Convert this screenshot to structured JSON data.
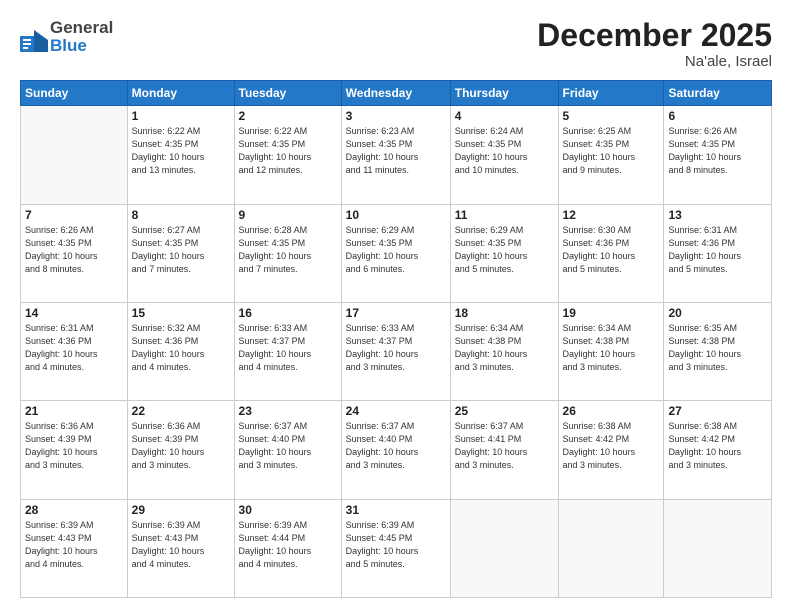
{
  "header": {
    "logo_general": "General",
    "logo_blue": "Blue",
    "title": "December 2025",
    "subtitle": "Na'ale, Israel"
  },
  "calendar": {
    "weekdays": [
      "Sunday",
      "Monday",
      "Tuesday",
      "Wednesday",
      "Thursday",
      "Friday",
      "Saturday"
    ],
    "weeks": [
      [
        {
          "day": "",
          "info": ""
        },
        {
          "day": "1",
          "info": "Sunrise: 6:22 AM\nSunset: 4:35 PM\nDaylight: 10 hours\nand 13 minutes."
        },
        {
          "day": "2",
          "info": "Sunrise: 6:22 AM\nSunset: 4:35 PM\nDaylight: 10 hours\nand 12 minutes."
        },
        {
          "day": "3",
          "info": "Sunrise: 6:23 AM\nSunset: 4:35 PM\nDaylight: 10 hours\nand 11 minutes."
        },
        {
          "day": "4",
          "info": "Sunrise: 6:24 AM\nSunset: 4:35 PM\nDaylight: 10 hours\nand 10 minutes."
        },
        {
          "day": "5",
          "info": "Sunrise: 6:25 AM\nSunset: 4:35 PM\nDaylight: 10 hours\nand 9 minutes."
        },
        {
          "day": "6",
          "info": "Sunrise: 6:26 AM\nSunset: 4:35 PM\nDaylight: 10 hours\nand 8 minutes."
        }
      ],
      [
        {
          "day": "7",
          "info": "Sunrise: 6:26 AM\nSunset: 4:35 PM\nDaylight: 10 hours\nand 8 minutes."
        },
        {
          "day": "8",
          "info": "Sunrise: 6:27 AM\nSunset: 4:35 PM\nDaylight: 10 hours\nand 7 minutes."
        },
        {
          "day": "9",
          "info": "Sunrise: 6:28 AM\nSunset: 4:35 PM\nDaylight: 10 hours\nand 7 minutes."
        },
        {
          "day": "10",
          "info": "Sunrise: 6:29 AM\nSunset: 4:35 PM\nDaylight: 10 hours\nand 6 minutes."
        },
        {
          "day": "11",
          "info": "Sunrise: 6:29 AM\nSunset: 4:35 PM\nDaylight: 10 hours\nand 5 minutes."
        },
        {
          "day": "12",
          "info": "Sunrise: 6:30 AM\nSunset: 4:36 PM\nDaylight: 10 hours\nand 5 minutes."
        },
        {
          "day": "13",
          "info": "Sunrise: 6:31 AM\nSunset: 4:36 PM\nDaylight: 10 hours\nand 5 minutes."
        }
      ],
      [
        {
          "day": "14",
          "info": "Sunrise: 6:31 AM\nSunset: 4:36 PM\nDaylight: 10 hours\nand 4 minutes."
        },
        {
          "day": "15",
          "info": "Sunrise: 6:32 AM\nSunset: 4:36 PM\nDaylight: 10 hours\nand 4 minutes."
        },
        {
          "day": "16",
          "info": "Sunrise: 6:33 AM\nSunset: 4:37 PM\nDaylight: 10 hours\nand 4 minutes."
        },
        {
          "day": "17",
          "info": "Sunrise: 6:33 AM\nSunset: 4:37 PM\nDaylight: 10 hours\nand 3 minutes."
        },
        {
          "day": "18",
          "info": "Sunrise: 6:34 AM\nSunset: 4:38 PM\nDaylight: 10 hours\nand 3 minutes."
        },
        {
          "day": "19",
          "info": "Sunrise: 6:34 AM\nSunset: 4:38 PM\nDaylight: 10 hours\nand 3 minutes."
        },
        {
          "day": "20",
          "info": "Sunrise: 6:35 AM\nSunset: 4:38 PM\nDaylight: 10 hours\nand 3 minutes."
        }
      ],
      [
        {
          "day": "21",
          "info": "Sunrise: 6:36 AM\nSunset: 4:39 PM\nDaylight: 10 hours\nand 3 minutes."
        },
        {
          "day": "22",
          "info": "Sunrise: 6:36 AM\nSunset: 4:39 PM\nDaylight: 10 hours\nand 3 minutes."
        },
        {
          "day": "23",
          "info": "Sunrise: 6:37 AM\nSunset: 4:40 PM\nDaylight: 10 hours\nand 3 minutes."
        },
        {
          "day": "24",
          "info": "Sunrise: 6:37 AM\nSunset: 4:40 PM\nDaylight: 10 hours\nand 3 minutes."
        },
        {
          "day": "25",
          "info": "Sunrise: 6:37 AM\nSunset: 4:41 PM\nDaylight: 10 hours\nand 3 minutes."
        },
        {
          "day": "26",
          "info": "Sunrise: 6:38 AM\nSunset: 4:42 PM\nDaylight: 10 hours\nand 3 minutes."
        },
        {
          "day": "27",
          "info": "Sunrise: 6:38 AM\nSunset: 4:42 PM\nDaylight: 10 hours\nand 3 minutes."
        }
      ],
      [
        {
          "day": "28",
          "info": "Sunrise: 6:39 AM\nSunset: 4:43 PM\nDaylight: 10 hours\nand 4 minutes."
        },
        {
          "day": "29",
          "info": "Sunrise: 6:39 AM\nSunset: 4:43 PM\nDaylight: 10 hours\nand 4 minutes."
        },
        {
          "day": "30",
          "info": "Sunrise: 6:39 AM\nSunset: 4:44 PM\nDaylight: 10 hours\nand 4 minutes."
        },
        {
          "day": "31",
          "info": "Sunrise: 6:39 AM\nSunset: 4:45 PM\nDaylight: 10 hours\nand 5 minutes."
        },
        {
          "day": "",
          "info": ""
        },
        {
          "day": "",
          "info": ""
        },
        {
          "day": "",
          "info": ""
        }
      ]
    ]
  }
}
